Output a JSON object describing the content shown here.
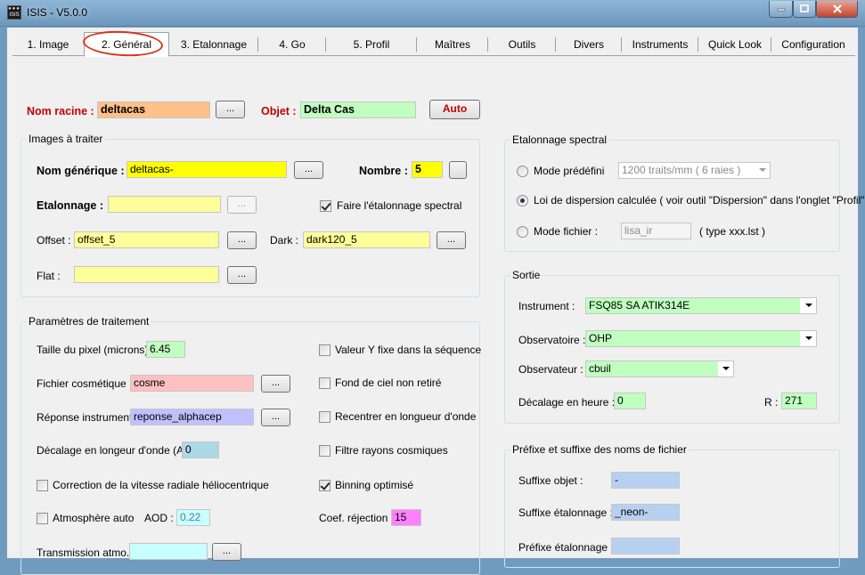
{
  "window": {
    "title": "ISIS - V5.0.0",
    "icon": "isis-app-icon"
  },
  "tabs": [
    {
      "label": "1. Image"
    },
    {
      "label": "2. Général"
    },
    {
      "label": "3. Etalonnage"
    },
    {
      "label": "4. Go"
    },
    {
      "label": "5. Profil"
    },
    {
      "label": "Maîtres"
    },
    {
      "label": "Outils"
    },
    {
      "label": "Divers"
    },
    {
      "label": "Instruments"
    },
    {
      "label": "Quick Look"
    },
    {
      "label": "Configuration"
    }
  ],
  "header": {
    "nom_racine_label": "Nom racine :",
    "nom_racine_value": "deltacas",
    "browse_label": "...",
    "objet_label": "Objet :",
    "objet_value": "Delta Cas",
    "auto_label": "Auto"
  },
  "images": {
    "title": "Images à traiter",
    "nom_generique_label": "Nom générique :",
    "nom_generique_value": "deltacas-",
    "nombre_label": "Nombre :",
    "nombre_value": "5",
    "etalonnage_label": "Etalonnage :",
    "etalonnage_value": "",
    "faire_etalonnage_label": "Faire l'étalonnage spectral",
    "offset_label": "Offset :",
    "offset_value": "offset_5",
    "dark_label": "Dark :",
    "dark_value": "dark120_5",
    "flat_label": "Flat :",
    "flat_value": ""
  },
  "params": {
    "title": "Paramètres de traitement",
    "taille_pixel_label": "Taille du pixel (microns) :",
    "taille_pixel_value": "6.45",
    "cosmetique_label": "Fichier cosmétique :",
    "cosmetique_value": "cosme",
    "reponse_label": "Réponse instrument :",
    "reponse_value": "reponse_alphacep",
    "decalage_label": "Décalage en longeur d'onde (A) :",
    "decalage_value": "0",
    "vitesse_label": "Correction de la vitesse radiale héliocentrique",
    "atmosphere_label": "Atmosphère auto",
    "aod_label": "AOD :",
    "aod_value": "0.22",
    "transmission_label": "Transmission atmo. :",
    "transmission_value": "",
    "valeur_y_label": "Valeur Y fixe dans la séquence",
    "fond_ciel_label": "Fond de ciel non retiré",
    "recentrer_label": "Recentrer en longueur d'onde",
    "filtre_label": "Filtre rayons cosmiques",
    "binning_label": "Binning optimisé",
    "coef_label": "Coef. réjection :",
    "coef_value": "15"
  },
  "etalonnage_spectral": {
    "title": "Etalonnage spectral",
    "mode_predefini_label": "Mode prédéfini",
    "mode_predefini_value": "1200 traits/mm ( 6 raies )",
    "loi_dispersion_label": "Loi de dispersion calculée ( voir outil \"Dispersion\" dans l'onglet \"Profil\" )",
    "mode_fichier_label": "Mode fichier :",
    "mode_fichier_value": "lisa_ir",
    "type_label": "( type xxx.lst )"
  },
  "sortie": {
    "title": "Sortie",
    "instrument_label": "Instrument :",
    "instrument_value": "FSQ85 SA ATIK314E",
    "observatoire_label": "Observatoire :",
    "observatoire_value": "OHP",
    "observateur_label": "Observateur :",
    "observateur_value": "cbuil",
    "decalage_heure_label": "Décalage en heure :",
    "decalage_heure_value": "0",
    "r_label": "R :",
    "r_value": "271"
  },
  "suffixes": {
    "title": "Préfixe et suffixe des noms de fichier",
    "suffixe_objet_label": "Suffixe objet :",
    "suffixe_objet_value": "-",
    "suffixe_etal_label": "Suffixe étalonnage :",
    "suffixe_etal_value": "_neon-",
    "prefixe_etal_label": "Préfixe étalonnage :",
    "prefixe_etal_value": ""
  },
  "colors": {
    "orange_field": "#ffc08a",
    "green_field": "#c0ffc0",
    "yellow_bright": "#ffff00",
    "yellow_pale": "#ffff99",
    "pink_field": "#ffc0c0",
    "lavender_field": "#c0c0ff",
    "lightblue_field": "#add8e6",
    "cyan_pale": "#c8ffff",
    "magenta_field": "#ff80ff",
    "steelblue_field": "#b8d0f0",
    "annotation_red": "#d9331f"
  }
}
